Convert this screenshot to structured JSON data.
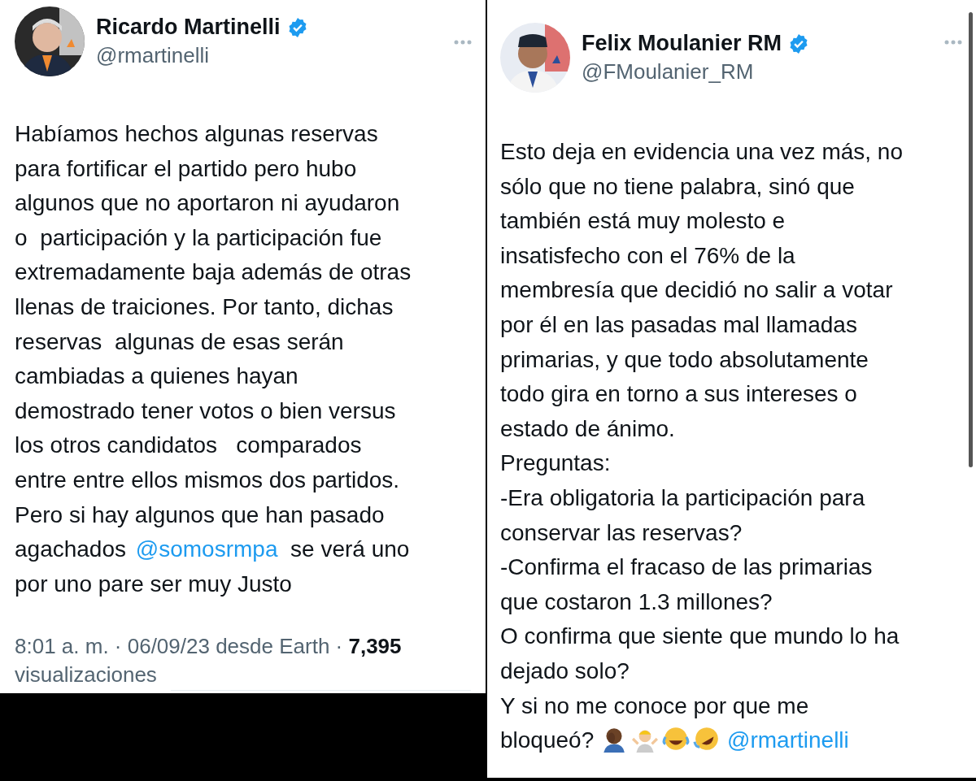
{
  "tweets": [
    {
      "name": "Ricardo Martinelli",
      "verified": true,
      "handle": "@rmartinelli",
      "body": [
        {
          "kind": "text",
          "text": "Habíamos hechos algunas reservas\npara fortificar el partido pero hubo\nalgunos que no aportaron ni ayudaron\no  participación y la participación fue\nextremadamente baja además de otras\nllenas de traiciones. Por tanto, dichas\nreservas  algunas de esas serán\ncambiadas a quienes hayan\ndemostrado tener votos o bien versus\nlos otros candidatos   comparados\nentre entre ellos mismos dos partidos.\nPero si hay algunos que han pasado\nagachados "
        },
        {
          "kind": "mention",
          "text": "@somosrmpa"
        },
        {
          "kind": "text",
          "text": "  se verá uno\npor uno pare ser muy Justo"
        }
      ],
      "footer": "8:01 a. m. · 06/09/23 desde Earth · **7,395** visualizaciones"
    },
    {
      "name": "Felix Moulanier RM",
      "verified": true,
      "handle": "@FMoulanier_RM",
      "body": [
        {
          "kind": "text",
          "text": "Esto deja en evidencia una vez más, no\nsólo que no tiene palabra, sinó que\ntambién está muy molesto e\ninsatisfecho con el 76% de la\nmembresía que decidió no salir a votar\npor él en las pasadas mal llamadas\nprimarias, y que todo absolutamente\ntodo gira en torno a sus intereses o\nestado de ánimo.\nPreguntas:\n-Era obligatoria la participación para\nconservar las reservas?\n-Confirma el fracaso de las primarias\nque costaron 1.3 millones?\nO confirma que siente que mundo lo ha\ndejado solo?\nY si no me conoce por que me\nbloqueó? "
        },
        {
          "kind": "emoji"
        },
        {
          "kind": "emoji"
        },
        {
          "kind": "emoji"
        },
        {
          "kind": "emoji"
        },
        {
          "kind": "mention",
          "text": "@rmartinelli"
        }
      ]
    }
  ]
}
